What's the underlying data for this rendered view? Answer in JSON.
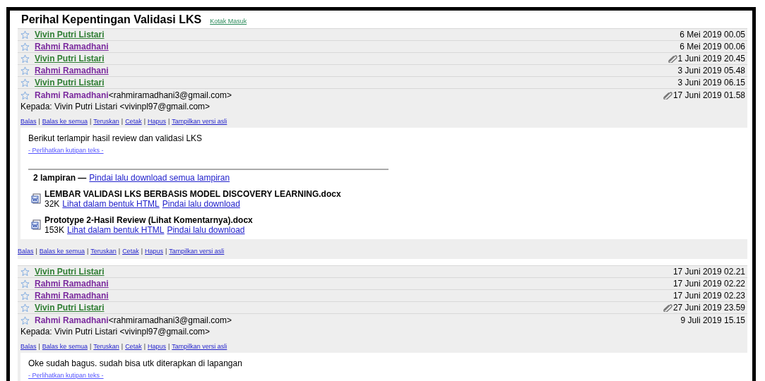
{
  "subject": "Perihal Kepentingan Validasi LKS",
  "folder_link": "Kotak Masuk",
  "action_separator": "|",
  "threads": [
    {
      "messages": [
        {
          "kind": "collapsed",
          "sender": "Vivin Putri Listari",
          "color": "#2e7d32",
          "date": "6 Mei 2019 00.05",
          "attachment": false
        },
        {
          "kind": "collapsed",
          "sender": "Rahmi Ramadhani",
          "color": "#7b2a9e",
          "date": "6 Mei 2019 00.06",
          "attachment": false
        },
        {
          "kind": "collapsed",
          "sender": "Vivin Putri Listari",
          "color": "#2e7d32",
          "date": "1 Juni 2019 20.45",
          "attachment": true
        },
        {
          "kind": "collapsed",
          "sender": "Rahmi Ramadhani",
          "color": "#7b2a9e",
          "date": "3 Juni 2019 05.48",
          "attachment": false
        },
        {
          "kind": "collapsed",
          "sender": "Vivin Putri Listari",
          "color": "#2e7d32",
          "date": "3 Juni 2019 06.15",
          "attachment": false
        },
        {
          "kind": "expanded",
          "sender": "Rahmi Ramadhani",
          "color": "#7b2a9e",
          "email": "<rahmiramadhani3@gmail.com>",
          "date": "17 Juni 2019 01.58",
          "attachment": true,
          "to": "Kepada: Vivin Putri Listari <vivinpl97@gmail.com>",
          "actions": [
            "Balas",
            "Balas ke semua",
            "Teruskan",
            "Cetak",
            "Hapus",
            "Tampilkan versi asli"
          ],
          "body": "Berikut terlampir hasil review dan validasi LKS",
          "quote_link": "- Perlihatkan kutipan teks -",
          "attachments_header": {
            "count": "2 lampiran —",
            "link": "Pindai lalu download semua lampiran"
          },
          "files": [
            {
              "name": "LEMBAR VALIDASI LKS BERBASIS MODEL DISCOVERY LEARNING.docx",
              "size": "32K",
              "links": [
                "Lihat dalam bentuk HTML",
                "Pindai lalu download"
              ]
            },
            {
              "name": "Prototype 2-Hasil Review (Lihat Komentarnya).docx",
              "size": "153K",
              "links": [
                "Lihat dalam bentuk HTML",
                "Pindai lalu download"
              ]
            }
          ],
          "footer_actions": [
            "Balas",
            "Balas ke semua",
            "Teruskan",
            "Cetak",
            "Hapus",
            "Tampilkan versi asli"
          ]
        }
      ]
    },
    {
      "messages": [
        {
          "kind": "collapsed",
          "sender": "Vivin Putri Listari",
          "color": "#2e7d32",
          "date": "17 Juni 2019 02.21",
          "attachment": false
        },
        {
          "kind": "collapsed",
          "sender": "Rahmi Ramadhani",
          "color": "#7b2a9e",
          "date": "17 Juni 2019 02.22",
          "attachment": false
        },
        {
          "kind": "collapsed",
          "sender": "Rahmi Ramadhani",
          "color": "#7b2a9e",
          "date": "17 Juni 2019 02.23",
          "attachment": false
        },
        {
          "kind": "collapsed",
          "sender": "Vivin Putri Listari",
          "color": "#2e7d32",
          "date": "27 Juni 2019 23.59",
          "attachment": true
        },
        {
          "kind": "expanded",
          "sender": "Rahmi Ramadhani",
          "color": "#7b2a9e",
          "email": "<rahmiramadhani3@gmail.com>",
          "date": "9 Juli 2019 15.15",
          "attachment": false,
          "to": "Kepada: Vivin Putri Listari <vivinpl97@gmail.com>",
          "actions": [
            "Balas",
            "Balas ke semua",
            "Teruskan",
            "Cetak",
            "Hapus",
            "Tampilkan versi asli"
          ],
          "body": "Oke sudah bagus. sudah bisa utk diterapkan di lapangan",
          "quote_link": "- Perlihatkan kutipan teks -"
        }
      ]
    }
  ]
}
